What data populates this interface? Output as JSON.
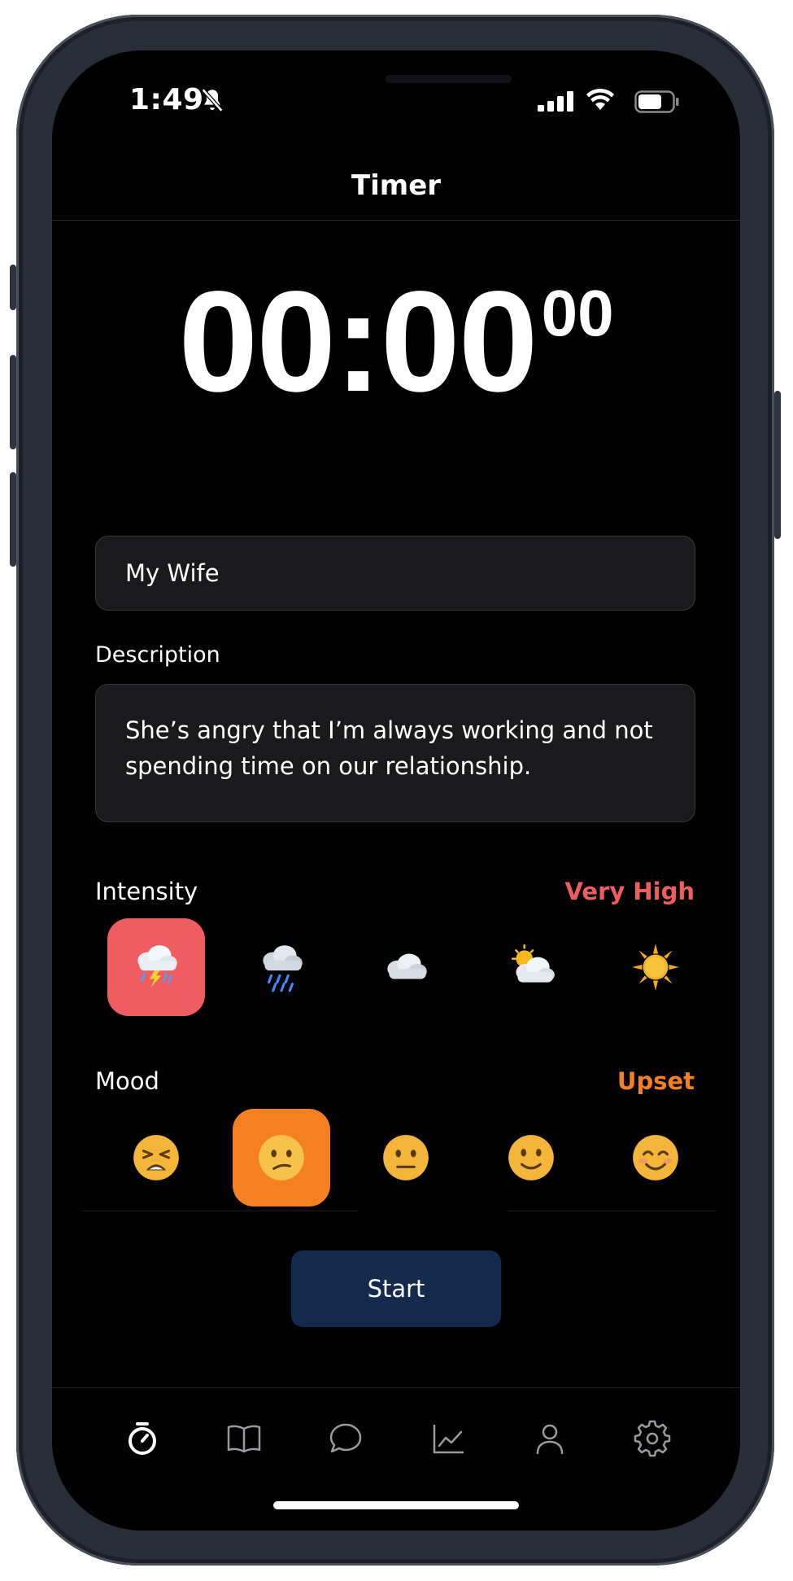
{
  "status_bar": {
    "time": "1:49"
  },
  "header": {
    "title": "Timer"
  },
  "timer": {
    "main": "00:00",
    "hundredths": "00"
  },
  "form": {
    "title_value": "My Wife",
    "description_label": "Description",
    "description_value": "She’s angry that I’m always working and not spending time on our relationship."
  },
  "intensity": {
    "label": "Intensity",
    "value": "Very High",
    "value_color": "#ef5d63",
    "options": [
      {
        "icon": "thunderstorm-icon",
        "selected": true
      },
      {
        "icon": "rain-cloud-icon",
        "selected": false
      },
      {
        "icon": "cloud-icon",
        "selected": false
      },
      {
        "icon": "sun-behind-cloud-icon",
        "selected": false
      },
      {
        "icon": "sun-icon",
        "selected": false
      }
    ]
  },
  "mood": {
    "label": "Mood",
    "value": "Upset",
    "value_color": "#f58022",
    "options": [
      {
        "icon": "tired-face-icon",
        "selected": false
      },
      {
        "icon": "confused-face-icon",
        "selected": true
      },
      {
        "icon": "neutral-face-icon",
        "selected": false
      },
      {
        "icon": "slightly-smiling-face-icon",
        "selected": false
      },
      {
        "icon": "smiling-face-icon",
        "selected": false
      }
    ]
  },
  "actions": {
    "start_label": "Start"
  },
  "tab_bar": {
    "active": "timer",
    "tabs": [
      "stopwatch-icon",
      "book-icon",
      "chat-bubble-icon",
      "chart-icon",
      "person-icon",
      "gear-icon"
    ]
  },
  "colors": {
    "accent_button": "#142a4c",
    "background": "#000000"
  }
}
